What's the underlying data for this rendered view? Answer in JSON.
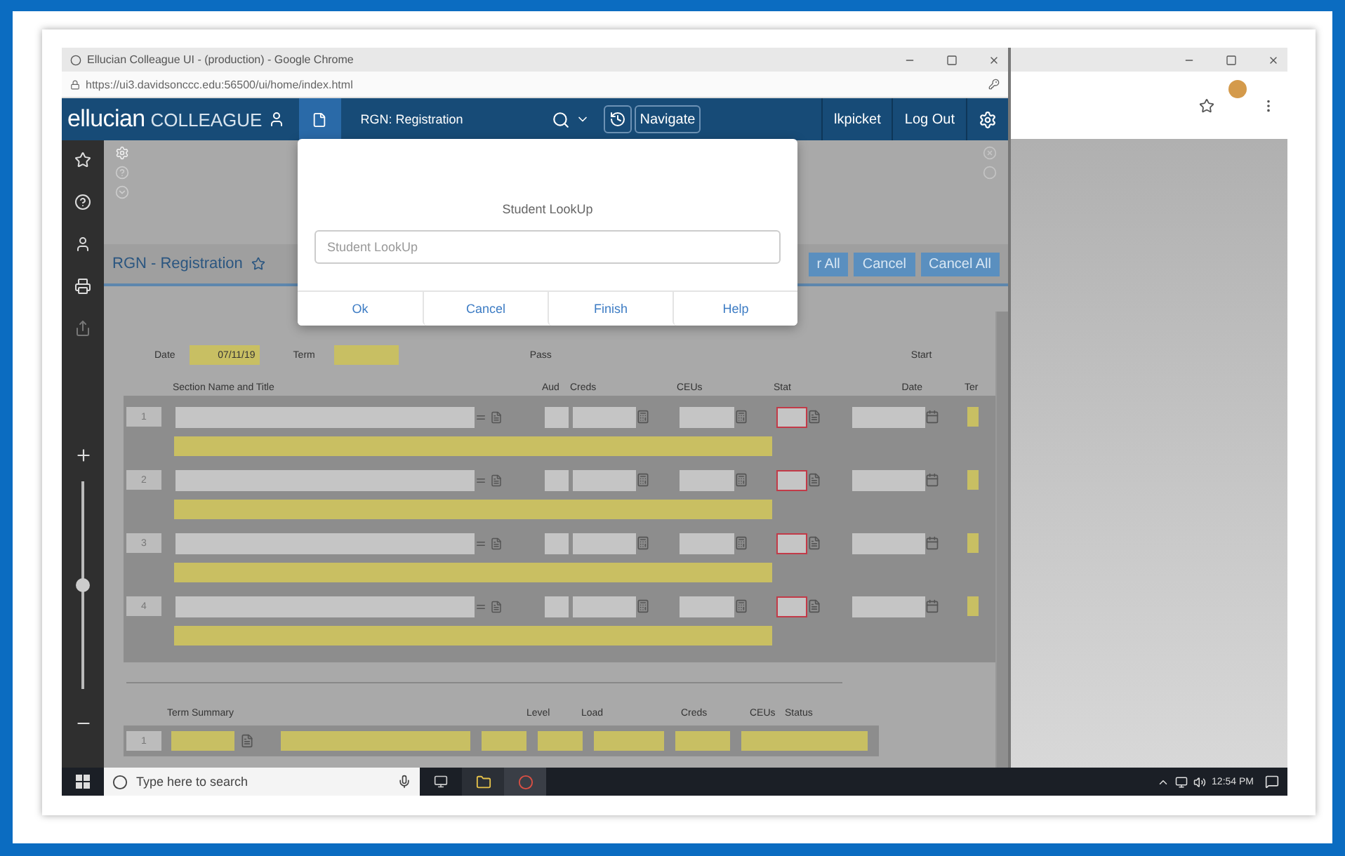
{
  "browser": {
    "title": "Ellucian Colleague UI - (production) - Google Chrome",
    "url": "https://ui3.davidsonccc.edu:56500/ui/home/index.html"
  },
  "app": {
    "brand": "ellucian",
    "product": "COLLEAGUE",
    "form": "RGN: Registration",
    "navigate": "Navigate",
    "user": "lkpicket",
    "logout": "Log Out"
  },
  "sidebar": {
    "zoom": {
      "level": 0.5
    }
  },
  "form": {
    "title": "RGN - Registration",
    "buttons": [
      "r All",
      "Cancel",
      "Cancel All"
    ],
    "date_label": "Date",
    "date": "07/11/19",
    "term_label": "Term",
    "pass": "Pass",
    "start": "Start",
    "columns": [
      "Section Name and Title",
      "Aud",
      "Creds",
      "CEUs",
      "Stat",
      "Date",
      "Ter"
    ],
    "rows": [
      "1",
      "2",
      "3",
      "4"
    ]
  },
  "term_summary": {
    "columns": [
      "Term Summary",
      "Level",
      "Load",
      "Creds",
      "CEUs",
      "Status"
    ],
    "rows": [
      "1"
    ]
  },
  "dialog": {
    "title": "Student LookUp",
    "placeholder": "Student LookUp",
    "buttons": [
      "Ok",
      "Cancel",
      "Finish",
      "Help"
    ]
  },
  "taskbar": {
    "search_placeholder": "Type here to search",
    "time": "12:54 PM"
  }
}
